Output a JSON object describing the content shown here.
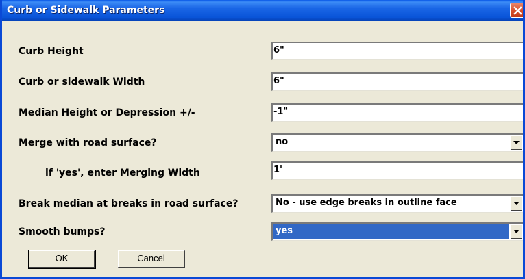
{
  "window": {
    "title": "Curb or Sidewalk Parameters",
    "close_icon": "close-x-icon"
  },
  "fields": {
    "curb_height": {
      "label": "Curb Height",
      "value": "6\""
    },
    "curb_width": {
      "label": "Curb or sidewalk Width",
      "value": "6\""
    },
    "median_height": {
      "label": "Median Height or Depression +/-",
      "value": "-1\""
    },
    "merge": {
      "label": "Merge with road surface?",
      "value": "no"
    },
    "merging_width": {
      "label": "if 'yes', enter Merging Width",
      "value": "1'"
    },
    "break_median": {
      "label": "Break median at breaks in road surface?",
      "value": "No - use edge breaks in outline face"
    },
    "smooth_bumps": {
      "label": "Smooth bumps?",
      "value": "yes"
    }
  },
  "buttons": {
    "ok": "OK",
    "cancel": "Cancel"
  },
  "colors": {
    "titlebar": "#0954d8",
    "close_button": "#d6502c",
    "dialog_background": "#ece9d8",
    "selection_highlight": "#3168c6"
  }
}
